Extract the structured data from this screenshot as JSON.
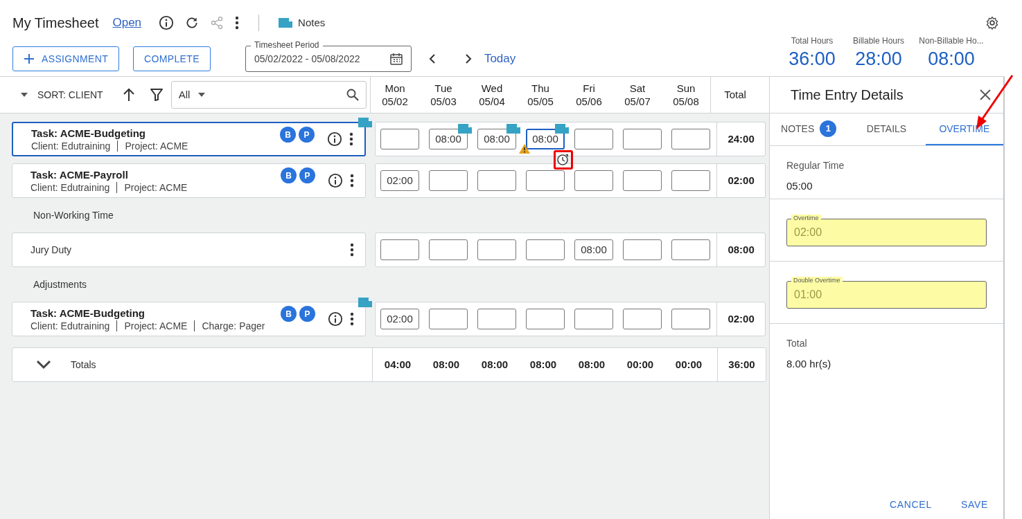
{
  "header": {
    "title": "My Timesheet",
    "status_link": "Open",
    "notes_label": "Notes"
  },
  "actions": [
    {
      "kind": "add",
      "label": "ASSIGNMENT"
    },
    {
      "kind": "plain",
      "label": "COMPLETE"
    }
  ],
  "period": {
    "label": "Timesheet Period",
    "value": "05/02/2022 - 05/08/2022"
  },
  "today_link": "Today",
  "summary": [
    {
      "label": "Total Hours",
      "value": "36:00"
    },
    {
      "label": "Billable Hours",
      "value": "28:00"
    },
    {
      "label": "Non-Billable Ho...",
      "value": "08:00"
    }
  ],
  "toolbar": {
    "sort_label": "SORT: CLIENT",
    "filter_value": "All"
  },
  "days": [
    {
      "name": "Mon",
      "date": "05/02"
    },
    {
      "name": "Tue",
      "date": "05/03"
    },
    {
      "name": "Wed",
      "date": "05/04"
    },
    {
      "name": "Thu",
      "date": "05/05"
    },
    {
      "name": "Fri",
      "date": "05/06"
    },
    {
      "name": "Sat",
      "date": "05/07"
    },
    {
      "name": "Sun",
      "date": "05/08"
    }
  ],
  "total_heading": "Total",
  "rows": [
    {
      "kind": "task",
      "title": "Task: ACME-Budgeting",
      "details": [
        "Client: Edutraining",
        "Project: ACME"
      ],
      "badges": [
        "B",
        "P"
      ],
      "selected": true,
      "note": true,
      "total": "24:00",
      "cells": [
        {
          "note": false,
          "selected": false,
          "warning": false,
          "overtime": false
        },
        {
          "value": "08:00",
          "note": true,
          "selected": false,
          "warning": false,
          "overtime": false
        },
        {
          "value": "08:00",
          "note": true,
          "selected": false,
          "warning": false,
          "overtime": false
        },
        {
          "value": "08:00",
          "note": true,
          "selected": true,
          "warning": true,
          "overtime": true
        },
        {
          "note": false,
          "selected": false,
          "warning": false,
          "overtime": false
        },
        {
          "note": false,
          "selected": false,
          "warning": false,
          "overtime": false
        },
        {
          "note": false,
          "selected": false,
          "warning": false,
          "overtime": false
        }
      ]
    },
    {
      "kind": "task",
      "title": "Task: ACME-Payroll",
      "details": [
        "Client: Edutraining",
        "Project: ACME"
      ],
      "badges": [
        "B",
        "P"
      ],
      "selected": false,
      "note": false,
      "total": "02:00",
      "cells": [
        {
          "value": "02:00",
          "note": false,
          "selected": false,
          "warning": false,
          "overtime": false
        },
        {
          "note": false,
          "selected": false,
          "warning": false,
          "overtime": false
        },
        {
          "note": false,
          "selected": false,
          "warning": false,
          "overtime": false
        },
        {
          "note": false,
          "selected": false,
          "warning": false,
          "overtime": false
        },
        {
          "note": false,
          "selected": false,
          "warning": false,
          "overtime": false
        },
        {
          "note": false,
          "selected": false,
          "warning": false,
          "overtime": false
        },
        {
          "note": false,
          "selected": false,
          "warning": false,
          "overtime": false
        }
      ]
    },
    {
      "kind": "section",
      "label": "Non-Working Time"
    },
    {
      "kind": "nonworking",
      "title": "Jury Duty",
      "selected": false,
      "note": false,
      "total": "08:00",
      "cells": [
        {
          "note": false,
          "selected": false,
          "warning": false,
          "overtime": false
        },
        {
          "note": false,
          "selected": false,
          "warning": false,
          "overtime": false
        },
        {
          "note": false,
          "selected": false,
          "warning": false,
          "overtime": false
        },
        {
          "note": false,
          "selected": false,
          "warning": false,
          "overtime": false
        },
        {
          "value": "08:00",
          "note": false,
          "selected": false,
          "warning": false,
          "overtime": false
        },
        {
          "note": false,
          "selected": false,
          "warning": false,
          "overtime": false
        },
        {
          "note": false,
          "selected": false,
          "warning": false,
          "overtime": false
        }
      ]
    },
    {
      "kind": "section",
      "label": "Adjustments"
    },
    {
      "kind": "task",
      "title": "Task: ACME-Budgeting",
      "details": [
        "Client: Edutraining",
        "Project: ACME",
        "Charge: Pager"
      ],
      "badges": [
        "B",
        "P"
      ],
      "selected": false,
      "note": true,
      "total": "02:00",
      "cells": [
        {
          "value": "02:00",
          "note": false,
          "selected": false,
          "warning": false,
          "overtime": false
        },
        {
          "note": false,
          "selected": false,
          "warning": false,
          "overtime": false
        },
        {
          "note": false,
          "selected": false,
          "warning": false,
          "overtime": false
        },
        {
          "note": false,
          "selected": false,
          "warning": false,
          "overtime": false
        },
        {
          "note": false,
          "selected": false,
          "warning": false,
          "overtime": false
        },
        {
          "note": false,
          "selected": false,
          "warning": false,
          "overtime": false
        },
        {
          "note": false,
          "selected": false,
          "warning": false,
          "overtime": false
        }
      ]
    }
  ],
  "totals": {
    "label": "Totals",
    "expanded": false,
    "values": [
      "04:00",
      "08:00",
      "08:00",
      "08:00",
      "08:00",
      "00:00",
      "00:00"
    ],
    "total": "36:00"
  },
  "panel": {
    "title": "Time Entry Details",
    "tabs": [
      {
        "label": "NOTES",
        "badge": "1",
        "selected": false
      },
      {
        "label": "DETAILS",
        "selected": false
      },
      {
        "label": "OVERTIME",
        "selected": true
      }
    ],
    "sections": [
      {
        "kind": "readonly",
        "label": "Regular Time",
        "value": "05:00"
      },
      {
        "kind": "field",
        "label": "Overtime",
        "value": "02:00",
        "highlighted": true
      },
      {
        "kind": "field",
        "label": "Double Overtime",
        "value": "01:00",
        "highlighted": true
      },
      {
        "kind": "readonly",
        "label": "Total",
        "value": "8.00 hr(s)"
      }
    ],
    "buttons": [
      "CANCEL",
      "SAVE"
    ]
  },
  "annotations": {
    "overtime_box": true,
    "arrow": true
  }
}
